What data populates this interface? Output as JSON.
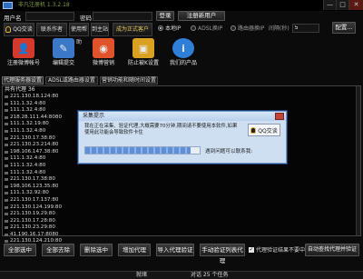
{
  "window": {
    "title": "非凡注册机 1.3.2.18",
    "min": "—",
    "max": "□",
    "close": "✕"
  },
  "login": {
    "user_label": "用户名",
    "user_value": "",
    "pass_label": "密码",
    "pass_value": "",
    "login_button": "登录",
    "register_button": "注册新用户"
  },
  "toolbar": {
    "qq_button": "QQ交谈",
    "contact_author": "联系作者",
    "help": "使用帮助",
    "goto": "到主站",
    "sponsor": "成为正式客户"
  },
  "radios": {
    "selected": "本地IP",
    "items": [
      "本地IP",
      "ADSL换IP",
      "路由器换IP"
    ]
  },
  "interval": {
    "label": "间隔(秒)",
    "value": "5",
    "config_button": "配置..."
  },
  "big_icons": [
    {
      "label": "注册微博帐号",
      "glyph": "👤",
      "color": "#d33a2c"
    },
    {
      "label": "编辑提交",
      "glyph": "✎",
      "color": "#3b78c8"
    },
    {
      "label": "微博营销",
      "glyph": "◉",
      "color": "#e0532b"
    },
    {
      "label": "防止被K设置",
      "glyph": "▣",
      "color": "#d9a021"
    },
    {
      "label": "我们的产品",
      "glyph": "i",
      "color": "#2f7fd8"
    }
  ],
  "tabs": [
    "代理服务器设置",
    "ADSL或路由器设置",
    "营销功能和随时间设置"
  ],
  "proxy": {
    "count_label": "共有代理 36",
    "items": [
      "221.130.18.124:80",
      "111.1.32.4:80",
      "111.1.32.4:80",
      "218.28.111.44:8080",
      "111.1.32.19:80",
      "111.1.32.4:80",
      "221.130.17.38:80",
      "221.130.23.214:80",
      "198.106.147.38:80",
      "111.1.32.4:80",
      "111.1.32.4:80",
      "111.1.32.4:80",
      "221.130.17.38:80",
      "198.106.123.35:80",
      "111.1.32.92:80",
      "221.130.17.137:80",
      "221.130.124.199:80",
      "221.130.19.29:80",
      "221.130.17.28:80",
      "221.130.23.29:80",
      "41.190.16.17:8080",
      "221.130.124.210:80"
    ]
  },
  "dialog": {
    "title": "采集提示",
    "message": "我在正在采集、验证代理,大概需要70分钟,期间请不要使用本软件,如果使用此功能会导致软件卡住",
    "qq_button": "QQ交谈",
    "progress": 0.92,
    "sub": "遇到问题可以联系我:"
  },
  "bottom_buttons": [
    "全部选中",
    "全部去除",
    "删除选中",
    "增加代理",
    "导入代理验证",
    "手动验证列表代理"
  ],
  "checkbox_label": "代理验证结果不要中国",
  "bottom_last": "自动查找代理并验证",
  "status": {
    "left": "就绪",
    "center": "对话 25 个任务"
  }
}
